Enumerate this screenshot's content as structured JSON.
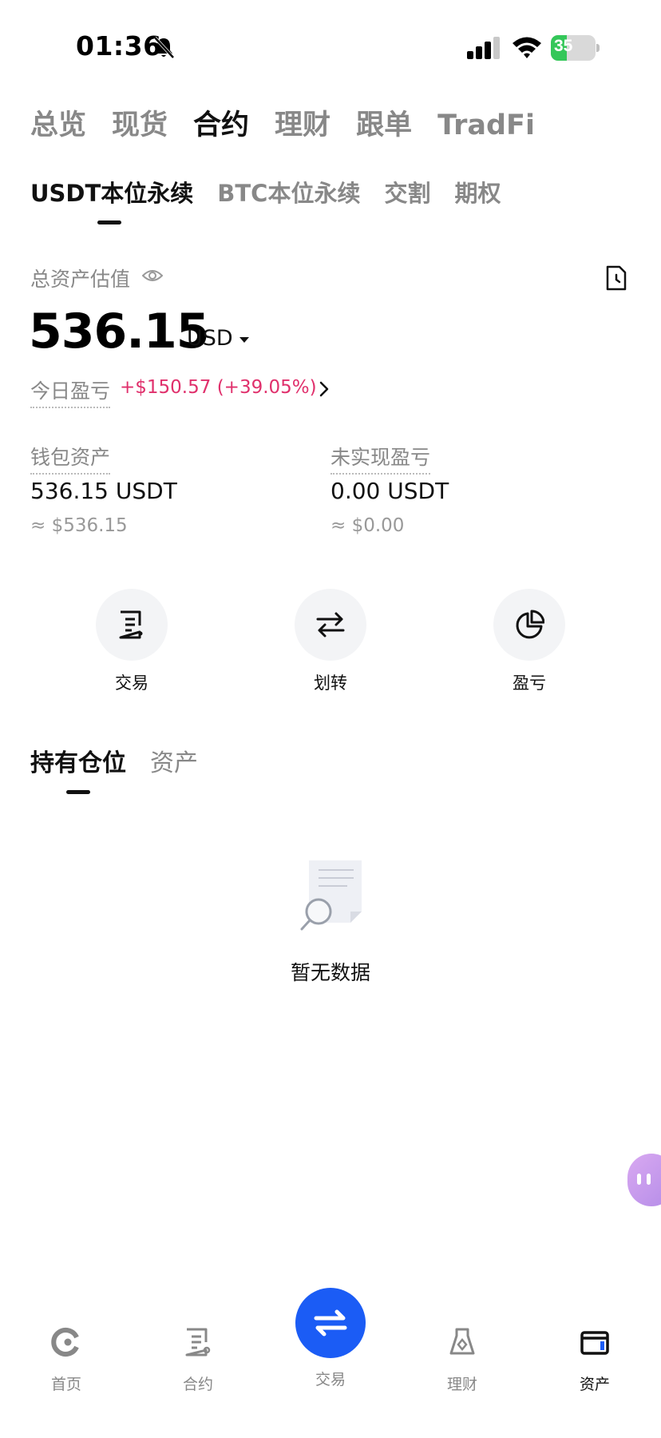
{
  "status_bar": {
    "time": "01:36",
    "battery": "35",
    "battery_level": 0.35
  },
  "top_tabs": [
    {
      "label": "总览",
      "active": false
    },
    {
      "label": "现货",
      "active": false
    },
    {
      "label": "合约",
      "active": true
    },
    {
      "label": "理财",
      "active": false
    },
    {
      "label": "跟单",
      "active": false
    },
    {
      "label": "TradFi",
      "active": false
    }
  ],
  "sub_tabs": [
    {
      "label": "USDT本位永续",
      "active": true
    },
    {
      "label": "BTC本位永续",
      "active": false
    },
    {
      "label": "交割",
      "active": false
    },
    {
      "label": "期权",
      "active": false
    }
  ],
  "summary": {
    "label": "总资产估值",
    "value": "536.15",
    "unit": "USD",
    "pnl_label": "今日盈亏",
    "pnl_value": "+$150.57 (+39.05%)"
  },
  "wallet": {
    "label": "钱包资产",
    "value": "536.15 USDT",
    "approx": "≈ $536.15"
  },
  "unrealized": {
    "label": "未实现盈亏",
    "value": "0.00 USDT",
    "approx": "≈ $0.00"
  },
  "actions": [
    {
      "label": "交易",
      "icon": "order-icon"
    },
    {
      "label": "划转",
      "icon": "transfer-icon"
    },
    {
      "label": "盈亏",
      "icon": "pie-chart-icon"
    }
  ],
  "position_tabs": [
    {
      "label": "持有仓位",
      "active": true
    },
    {
      "label": "资产",
      "active": false
    }
  ],
  "empty_state": {
    "text": "暂无数据"
  },
  "bottom_nav": [
    {
      "label": "首页",
      "icon": "home-icon",
      "active": false
    },
    {
      "label": "合约",
      "icon": "contract-icon",
      "active": false
    },
    {
      "label": "交易",
      "icon": "swap-icon",
      "active": false
    },
    {
      "label": "理财",
      "icon": "finance-icon",
      "active": false
    },
    {
      "label": "资产",
      "icon": "wallet-icon",
      "active": true
    }
  ],
  "colors": {
    "accent": "#1b5cf5",
    "profit": "#e0306c",
    "battery": "#34c759"
  }
}
